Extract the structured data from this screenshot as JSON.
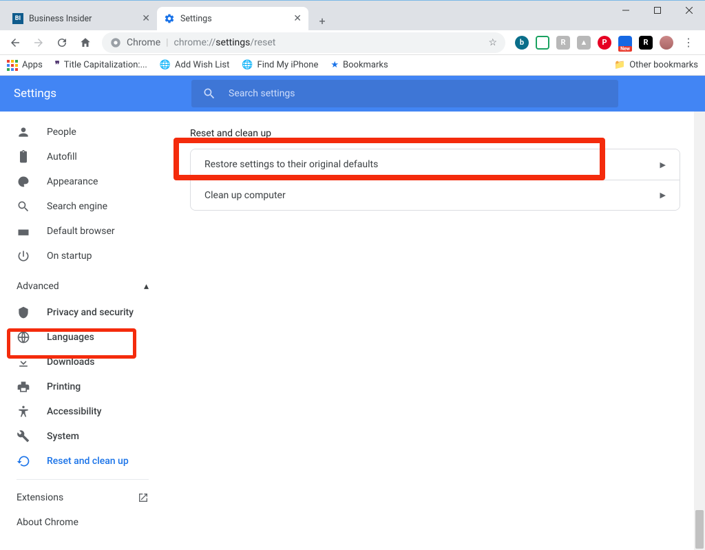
{
  "window": {
    "min": "—",
    "max": "☐",
    "close": "✕"
  },
  "tabs": [
    {
      "title": "Business Insider",
      "favicon_bg": "#0f5b8c",
      "favicon_text": "BI"
    },
    {
      "title": "Settings",
      "favicon_gear": true
    }
  ],
  "toolbar": {
    "chrome_label": "Chrome",
    "url_prefix": "chrome://",
    "url_bold": "settings",
    "url_rest": "/reset"
  },
  "ext_icons": [
    {
      "bg": "#0a6e8a",
      "text": "b"
    },
    {
      "bg": "#fff",
      "border": "#1aa260",
      "text": ""
    },
    {
      "bg": "#b8b8b8",
      "text": "R"
    },
    {
      "bg": "#b8b8b8",
      "text": ""
    },
    {
      "bg": "#e60023",
      "text": "P"
    },
    {
      "bg": "#1668e3",
      "text": ""
    },
    {
      "bg": "#000",
      "text": "R"
    }
  ],
  "bookmarks": {
    "apps": "Apps",
    "items": [
      {
        "label": "Title Capitalization:...",
        "icon": "quote"
      },
      {
        "label": "Add Wish List",
        "icon": "globe"
      },
      {
        "label": "Find My iPhone",
        "icon": "globe"
      },
      {
        "label": "Bookmarks",
        "icon": "star"
      }
    ],
    "other": "Other bookmarks"
  },
  "settings_header": {
    "title": "Settings",
    "search_placeholder": "Search settings"
  },
  "sidebar": {
    "items": [
      {
        "icon": "person",
        "label": "People"
      },
      {
        "icon": "clipboard",
        "label": "Autofill"
      },
      {
        "icon": "palette",
        "label": "Appearance"
      },
      {
        "icon": "search",
        "label": "Search engine"
      },
      {
        "icon": "browser",
        "label": "Default browser"
      },
      {
        "icon": "power",
        "label": "On startup"
      }
    ],
    "advanced": "Advanced",
    "adv_items": [
      {
        "icon": "shield",
        "label": "Privacy and security"
      },
      {
        "icon": "globe",
        "label": "Languages"
      },
      {
        "icon": "download",
        "label": "Downloads"
      },
      {
        "icon": "print",
        "label": "Printing"
      },
      {
        "icon": "accessibility",
        "label": "Accessibility"
      },
      {
        "icon": "wrench",
        "label": "System"
      },
      {
        "icon": "restore",
        "label": "Reset and clean up",
        "active": true
      }
    ],
    "extensions": "Extensions",
    "about": "About Chrome"
  },
  "content": {
    "section_title": "Reset and clean up",
    "rows": [
      {
        "label": "Restore settings to their original defaults"
      },
      {
        "label": "Clean up computer"
      }
    ]
  }
}
